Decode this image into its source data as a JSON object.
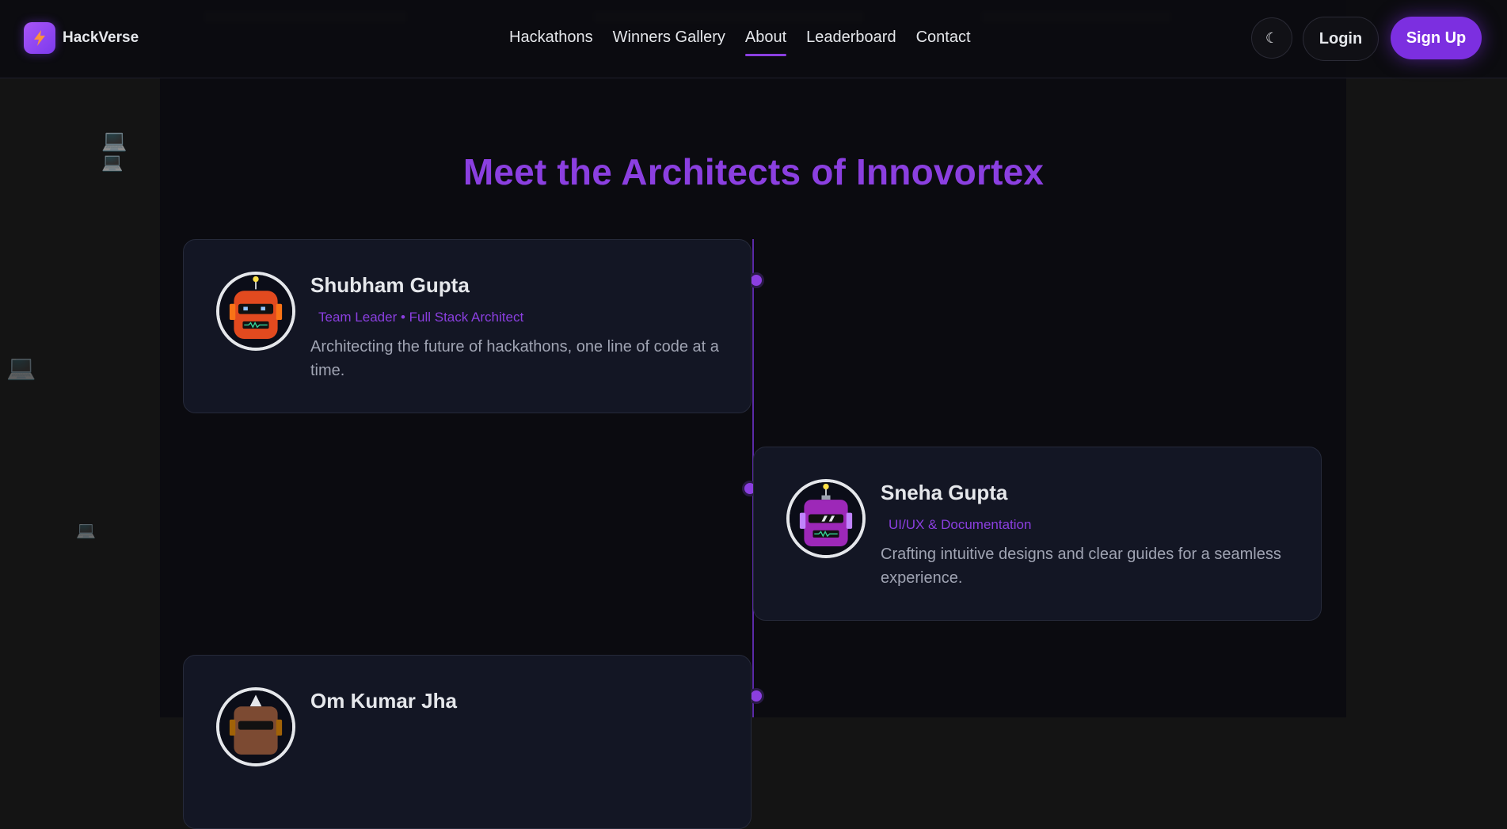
{
  "brand": {
    "name": "HackVerse"
  },
  "nav": {
    "items": [
      {
        "label": "Hackathons",
        "active": false
      },
      {
        "label": "Winners Gallery",
        "active": false
      },
      {
        "label": "About",
        "active": true
      },
      {
        "label": "Leaderboard",
        "active": false
      },
      {
        "label": "Contact",
        "active": false
      }
    ]
  },
  "header_actions": {
    "theme_icon": "☾",
    "login_label": "Login",
    "signup_label": "Sign Up"
  },
  "section": {
    "title": "Meet the Architects of Innovortex"
  },
  "team": [
    {
      "name": "Shubham Gupta",
      "role": "Team Leader • Full Stack Architect",
      "bio": "Architecting the future of hackathons, one line of code at a time.",
      "avatar": "orange-robot-icon"
    },
    {
      "name": "Sneha Gupta",
      "role": "UI/UX & Documentation",
      "bio": "Crafting intuitive designs and clear guides for a seamless experience.",
      "avatar": "purple-robot-icon"
    },
    {
      "name": "Om Kumar Jha",
      "role": "",
      "bio": "",
      "avatar": "brown-robot-icon"
    }
  ],
  "colors": {
    "accent": "#8b3fe0",
    "background": "#0b0b10",
    "card": "#131624"
  }
}
